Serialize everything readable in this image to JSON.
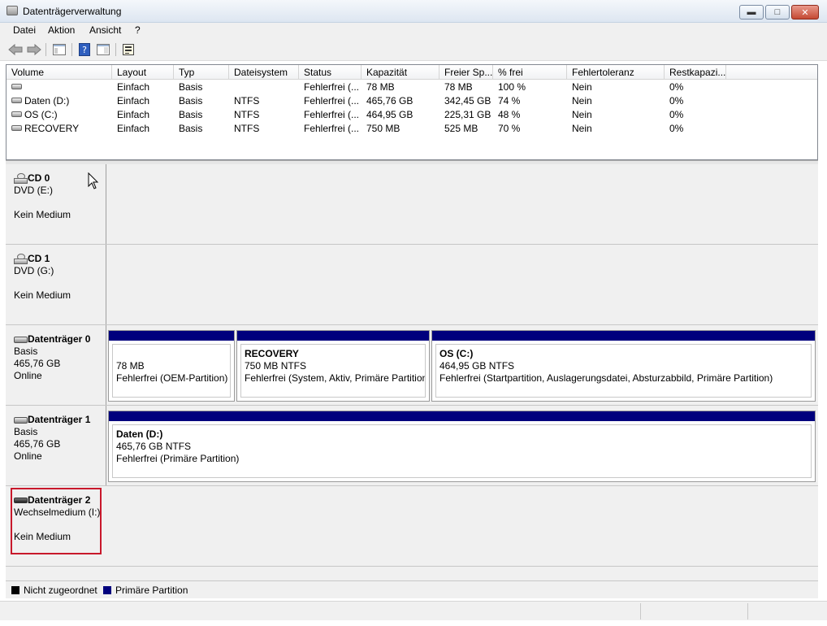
{
  "window": {
    "title": "Datenträgerverwaltung",
    "min": "▬",
    "max": "□",
    "close": "✕"
  },
  "menu": {
    "items": [
      "Datei",
      "Aktion",
      "Ansicht",
      "?"
    ]
  },
  "toolbar": {
    "buttons": [
      "back-arrow-icon",
      "forward-arrow-icon",
      "console-tree-icon",
      "help-icon",
      "details-pane-icon",
      "properties-icon"
    ]
  },
  "volume_list": {
    "columns": [
      "Volume",
      "Layout",
      "Typ",
      "Dateisystem",
      "Status",
      "Kapazität",
      "Freier Sp...",
      "% frei",
      "Fehlertoleranz",
      "Restkapazi..."
    ],
    "rows": [
      [
        "",
        "Einfach",
        "Basis",
        "",
        "Fehlerfrei (...",
        "78 MB",
        "78 MB",
        "100 %",
        "Nein",
        "0%"
      ],
      [
        "Daten (D:)",
        "Einfach",
        "Basis",
        "NTFS",
        "Fehlerfrei (...",
        "465,76 GB",
        "342,45 GB",
        "74 %",
        "Nein",
        "0%"
      ],
      [
        "OS (C:)",
        "Einfach",
        "Basis",
        "NTFS",
        "Fehlerfrei (...",
        "464,95 GB",
        "225,31 GB",
        "48 %",
        "Nein",
        "0%"
      ],
      [
        "RECOVERY",
        "Einfach",
        "Basis",
        "NTFS",
        "Fehlerfrei (...",
        "750 MB",
        "525 MB",
        "70 %",
        "Nein",
        "0%"
      ]
    ]
  },
  "disks": {
    "cd0": {
      "name": "CD 0",
      "line1": "DVD (E:)",
      "line2": "",
      "line3": "Kein Medium"
    },
    "cd1": {
      "name": "CD 1",
      "line1": "DVD (G:)",
      "line2": "",
      "line3": "Kein Medium"
    },
    "disk0": {
      "name": "Datenträger 0",
      "line1": "Basis",
      "line2": "465,76 GB",
      "line3": "Online",
      "partitions": [
        {
          "title": "",
          "size": "78 MB",
          "status": "Fehlerfrei (OEM-Partition)"
        },
        {
          "title": "RECOVERY",
          "size": "750 MB NTFS",
          "status": "Fehlerfrei (System, Aktiv, Primäre Partition)"
        },
        {
          "title": "OS  (C:)",
          "size": "464,95 GB NTFS",
          "status": "Fehlerfrei (Startpartition, Auslagerungsdatei, Absturzabbild, Primäre Partition)"
        }
      ]
    },
    "disk1": {
      "name": "Datenträger 1",
      "line1": "Basis",
      "line2": "465,76 GB",
      "line3": "Online",
      "partitions": [
        {
          "title": "Daten  (D:)",
          "size": "465,76 GB NTFS",
          "status": "Fehlerfrei (Primäre Partition)"
        }
      ]
    },
    "disk2": {
      "name": "Datenträger 2",
      "line1": "Wechselmedium (I:)",
      "line2": "",
      "line3": "Kein Medium"
    }
  },
  "legend": {
    "unallocated": {
      "label": "Nicht zugeordnet",
      "color": "#000000"
    },
    "primary": {
      "label": "Primäre Partition",
      "color": "#00007d"
    }
  },
  "colors": {
    "partition_bar": "#00007d",
    "selection_border": "#c8182b"
  }
}
